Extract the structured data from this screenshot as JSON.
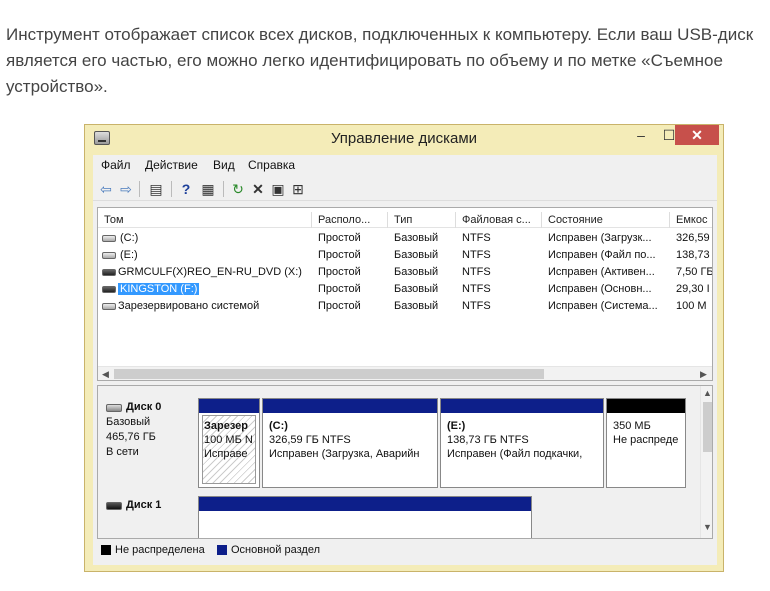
{
  "intro": "Инструмент отображает список всех дисков, подключенных к компьютеру. Если ваш USB-диск является его частью, его можно легко идентифицировать по объему и по метке «Съемное устройство».",
  "window": {
    "title": "Управление дисками",
    "controls": {
      "minimize": "–",
      "maximize": "☐",
      "close": "✕"
    }
  },
  "menu": [
    "Файл",
    "Действие",
    "Вид",
    "Справка"
  ],
  "toolbar_icons": [
    "back-arrow-icon",
    "forward-arrow-icon",
    "properties-list-icon",
    "help-icon",
    "view-icon",
    "refresh-icon",
    "delete-icon",
    "properties-icon",
    "settings-icon"
  ],
  "volume_columns": [
    "Том",
    "Располо...",
    "Тип",
    "Файловая с...",
    "Состояние",
    "Емкос"
  ],
  "volumes": [
    {
      "name": "(C:)",
      "layout": "Простой",
      "type": "Базовый",
      "fs": "NTFS",
      "status": "Исправен (Загрузк...",
      "capacity": "326,59",
      "icon": "disk-drive-icon"
    },
    {
      "name": "(E:)",
      "layout": "Простой",
      "type": "Базовый",
      "fs": "NTFS",
      "status": "Исправен (Файл по...",
      "capacity": "138,73",
      "icon": "disk-drive-icon"
    },
    {
      "name": "GRMCULF(X)REO_EN-RU_DVD (X:)",
      "layout": "Простой",
      "type": "Базовый",
      "fs": "NTFS",
      "status": "Исправен (Активен...",
      "capacity": "7,50 ГБ",
      "icon": "dvd-drive-icon"
    },
    {
      "name": "KINGSTON (F:)",
      "layout": "Простой",
      "type": "Базовый",
      "fs": "NTFS",
      "status": "Исправен (Основн...",
      "capacity": "29,30 I",
      "icon": "usb-drive-icon",
      "selected": true
    },
    {
      "name": "Зарезервировано системой",
      "layout": "Простой",
      "type": "Базовый",
      "fs": "NTFS",
      "status": "Исправен (Система...",
      "capacity": "100 М",
      "icon": "disk-drive-icon"
    }
  ],
  "disks": [
    {
      "title": "Диск 0",
      "kind": "Базовый",
      "size": "465,76 ГБ",
      "state": "В сети",
      "partitions": [
        {
          "name": "Зарезер",
          "size": "100 МБ N",
          "status": "Исправе",
          "hatched": true
        },
        {
          "name": "(C:)",
          "size": "326,59 ГБ NTFS",
          "status": "Исправен (Загрузка, Аварийн"
        },
        {
          "name": "(E:)",
          "size": "138,73 ГБ NTFS",
          "status": "Исправен (Файл подкачки,"
        },
        {
          "name": "",
          "size": "350 МБ",
          "status": "Не распреде",
          "unallocated": true
        }
      ]
    },
    {
      "title": "Диск 1"
    }
  ],
  "legend": [
    {
      "label": "Не распределена",
      "color": "#000000"
    },
    {
      "label": "Основной раздел",
      "color": "#0d1f8a"
    }
  ]
}
